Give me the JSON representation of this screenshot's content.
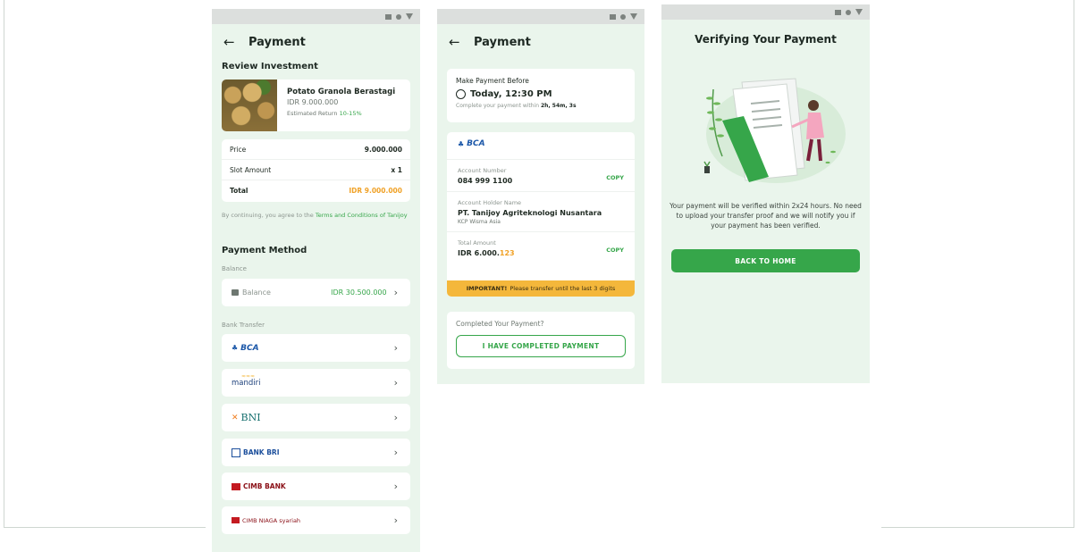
{
  "screen1": {
    "title": "Payment",
    "review_title": "Review Investment",
    "investment": {
      "name": "Potato Granola Berastagi",
      "price": "IDR 9.000.000",
      "return_label": "Estimated Return",
      "return_value": "10-15%"
    },
    "summary": [
      {
        "label": "Price",
        "value": "9.000.000"
      },
      {
        "label": "Slot Amount",
        "value": "x 1"
      },
      {
        "label": "Total",
        "value": "IDR 9.000.000"
      }
    ],
    "terms_prefix": "By continuing, you agree to the",
    "terms_link": "Terms and Conditions of Tanijoy",
    "payment_method_title": "Payment Method",
    "balance_section": "Balance",
    "balance_label": "Balance",
    "balance_value": "IDR 30.500.000",
    "bank_transfer_section": "Bank Transfer",
    "banks": [
      {
        "name": "BCA",
        "color": "#1b57a8"
      },
      {
        "name": "mandiri",
        "color": "#1b3f7a"
      },
      {
        "name": "BNI",
        "color": "#17706f"
      },
      {
        "name": "BANK BRI",
        "color": "#1c4f9c"
      },
      {
        "name": "CIMB BANK",
        "color": "#8a0f16"
      },
      {
        "name": "CIMB NIAGA syariah",
        "color": "#8a0f16"
      }
    ]
  },
  "screen2": {
    "title": "Payment",
    "make_before": "Make Payment Before",
    "deadline": "Today, 12:30 PM",
    "complete_within": "Complete your payment within",
    "countdown": "2h, 54m, 3s",
    "bank": "BCA",
    "account_number_label": "Account Number",
    "account_number": "084 999 1100",
    "holder_label": "Account Holder Name",
    "holder_name": "PT. Tanijoy Agriteknologi Nusantara",
    "holder_branch": "KCP Wisma Asia",
    "total_label": "Total Amount",
    "total_main": "IDR 6.000.",
    "total_digits": "123",
    "copy_label": "COPY",
    "important_bold": "IMPORTANT!",
    "important_text": "Please transfer until the last 3 digits",
    "completed_question": "Completed Your Payment?",
    "completed_button": "I HAVE COMPLETED PAYMENT"
  },
  "screen3": {
    "title": "Verifying Your Payment",
    "message": "Your payment will be verified within 2x24 hours. No need to upload your transfer proof and we will notify you if your payment has been verified.",
    "button": "BACK TO HOME"
  },
  "colors": {
    "accent_green": "#36a64a",
    "accent_orange": "#f0a126",
    "background": "#eaf5ec"
  }
}
